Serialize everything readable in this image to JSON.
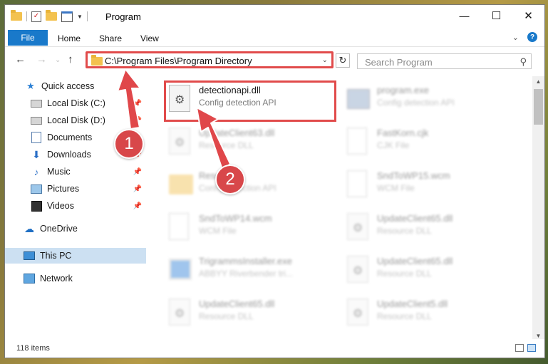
{
  "window": {
    "title": "Program",
    "controls": {
      "minimize": "—",
      "maximize": "☐",
      "close": "✕"
    }
  },
  "ribbon": {
    "file_tab": "File",
    "tabs": [
      "Home",
      "Share",
      "View"
    ],
    "help": "?"
  },
  "address_bar": {
    "path": "C:\\Program Files\\Program Directory",
    "back": "←",
    "forward": "→",
    "up": "↑",
    "dropdown": "⌄",
    "refresh": "↻"
  },
  "search": {
    "placeholder": "Search Program",
    "icon": "search-icon"
  },
  "sidebar": {
    "items": [
      {
        "label": "Quick access",
        "icon": "star-icon"
      },
      {
        "label": "Local Disk (C:)",
        "icon": "disk-icon",
        "pinned": true
      },
      {
        "label": "Local Disk (D:)",
        "icon": "disk-icon",
        "pinned": true
      },
      {
        "label": "Documents",
        "icon": "documents-icon",
        "pinned": true
      },
      {
        "label": "Downloads",
        "icon": "download-icon",
        "pinned": true
      },
      {
        "label": "Music",
        "icon": "music-icon",
        "pinned": true
      },
      {
        "label": "Pictures",
        "icon": "pictures-icon",
        "pinned": true
      },
      {
        "label": "Videos",
        "icon": "videos-icon",
        "pinned": true
      },
      {
        "label": "OneDrive",
        "icon": "cloud-icon"
      },
      {
        "label": "This PC",
        "icon": "pc-icon",
        "selected": true
      },
      {
        "label": "Network",
        "icon": "network-icon"
      }
    ]
  },
  "files": [
    {
      "name": "detectionapi.dll",
      "type": "Config detection API",
      "icon": "gear-file-icon",
      "highlighted": true
    },
    {
      "name": "program.exe",
      "type": "Config detection API",
      "icon": "exe-icon"
    },
    {
      "name": "UpdateClient63.dll",
      "type": "Resource DLL",
      "icon": "gear-file-icon"
    },
    {
      "name": "FastKorn.cjk",
      "type": "CJK File",
      "icon": "file-icon"
    },
    {
      "name": "Resources",
      "type": "Config detection API",
      "icon": "folder-icon"
    },
    {
      "name": "SndToWP15.wcm",
      "type": "WCM File",
      "icon": "file-icon"
    },
    {
      "name": "SndToWP14.wcm",
      "type": "WCM File",
      "icon": "file-icon"
    },
    {
      "name": "UpdateClient65.dll",
      "type": "Resource DLL",
      "icon": "gear-file-icon"
    },
    {
      "name": "TrigrammsInstaller.exe",
      "type": "ABBYY Riverbender tri...",
      "icon": "app-icon"
    },
    {
      "name": "UpdateClient65.dll",
      "type": "Resource DLL",
      "icon": "gear-file-icon"
    },
    {
      "name": "UpdateClient65.dll",
      "type": "Resource DLL",
      "icon": "gear-file-icon"
    },
    {
      "name": "UpdateClient5.dll",
      "type": "Resource DLL",
      "icon": "gear-file-icon"
    }
  ],
  "status": {
    "item_count": "118 items"
  },
  "callouts": {
    "step1": "1",
    "step2": "2"
  },
  "colors": {
    "accent": "#1979ca",
    "highlight": "#e14b4b",
    "badge": "#d8474a",
    "selected_bg": "#cce0f2"
  }
}
